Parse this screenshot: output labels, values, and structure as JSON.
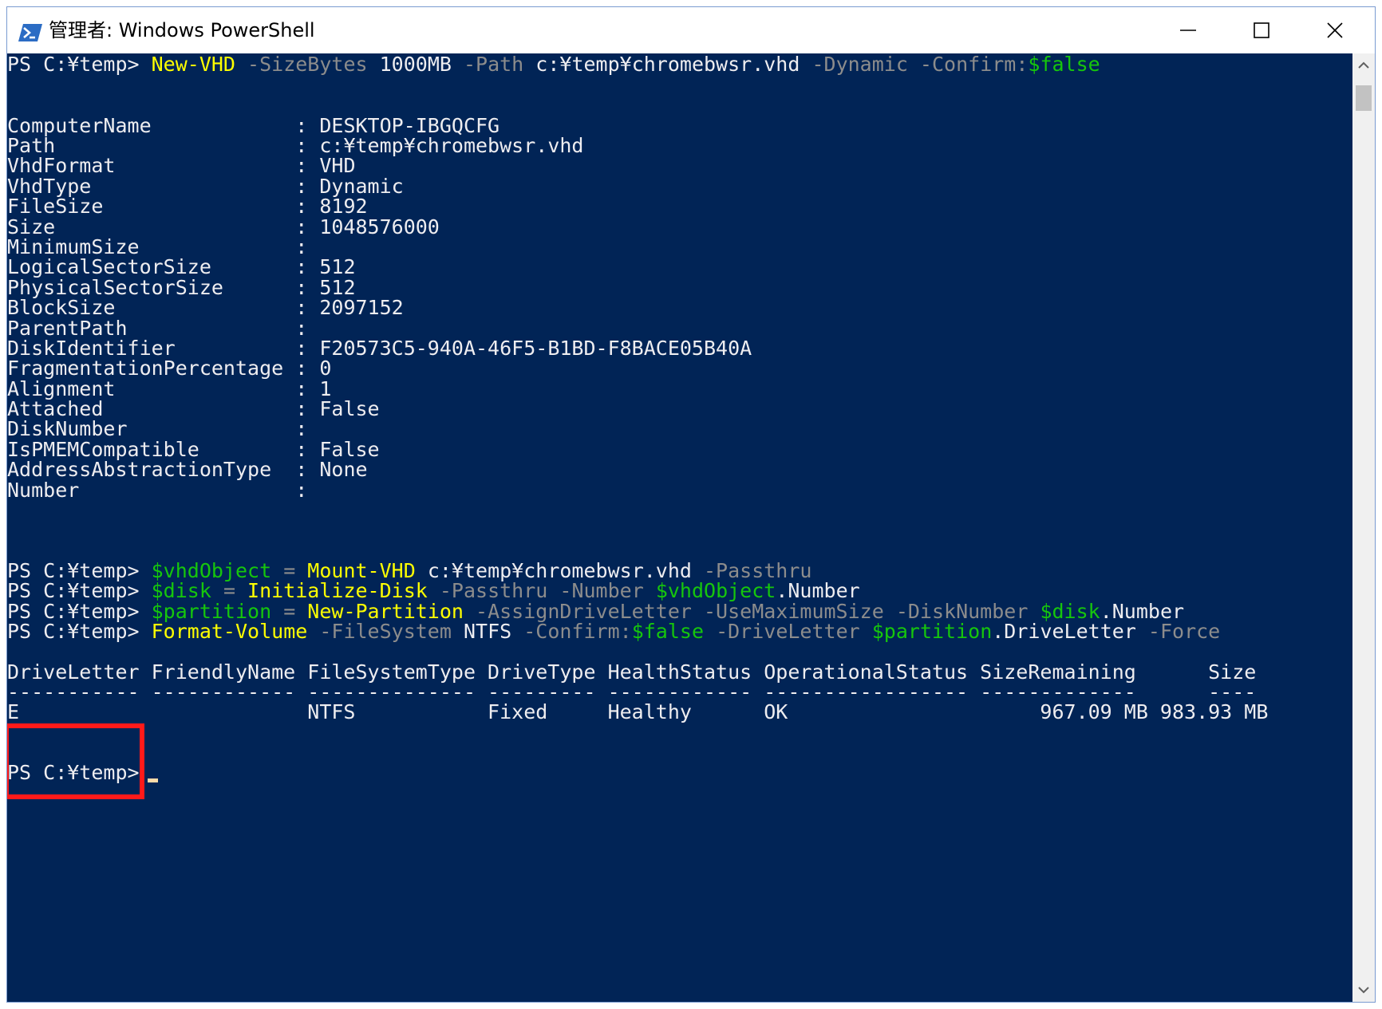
{
  "window": {
    "title": "管理者: Windows PowerShell"
  },
  "console": {
    "cmd1": {
      "prompt": "PS C:¥temp> ",
      "cmdlet": "New-VHD",
      "p1": " -SizeBytes",
      "v1": " 1000MB",
      "p2": " -Path",
      "v2": " c:¥temp¥chromebwsr.vhd",
      "p3": " -Dynamic -Confirm:",
      "v3": "$false"
    },
    "props": [
      {
        "name": "ComputerName           ",
        "value": "DESKTOP-IBGQCFG"
      },
      {
        "name": "Path                   ",
        "value": "c:¥temp¥chromebwsr.vhd"
      },
      {
        "name": "VhdFormat              ",
        "value": "VHD"
      },
      {
        "name": "VhdType                ",
        "value": "Dynamic"
      },
      {
        "name": "FileSize               ",
        "value": "8192"
      },
      {
        "name": "Size                   ",
        "value": "1048576000"
      },
      {
        "name": "MinimumSize            ",
        "value": ""
      },
      {
        "name": "LogicalSectorSize      ",
        "value": "512"
      },
      {
        "name": "PhysicalSectorSize     ",
        "value": "512"
      },
      {
        "name": "BlockSize              ",
        "value": "2097152"
      },
      {
        "name": "ParentPath             ",
        "value": ""
      },
      {
        "name": "DiskIdentifier         ",
        "value": "F20573C5-940A-46F5-B1BD-F8BACE05B40A"
      },
      {
        "name": "FragmentationPercentage",
        "value": "0"
      },
      {
        "name": "Alignment              ",
        "value": "1"
      },
      {
        "name": "Attached               ",
        "value": "False"
      },
      {
        "name": "DiskNumber             ",
        "value": ""
      },
      {
        "name": "IsPMEMCompatible       ",
        "value": "False"
      },
      {
        "name": "AddressAbstractionType ",
        "value": "None"
      },
      {
        "name": "Number                 ",
        "value": ""
      }
    ],
    "separator": " : ",
    "cmd2": {
      "prompt": "PS C:¥temp> ",
      "var": "$vhdObject",
      "eq": " = ",
      "cmdlet": "Mount-VHD",
      "arg": " c:¥temp¥chromebwsr.vhd",
      "p1": " -Passthru"
    },
    "cmd3": {
      "prompt": "PS C:¥temp> ",
      "var": "$disk",
      "eq": " = ",
      "cmdlet": "Initialize-Disk",
      "p1": " -Passthru -Number ",
      "v1": "$vhdObject",
      "v1b": ".Number"
    },
    "cmd4": {
      "prompt": "PS C:¥temp> ",
      "var": "$partition",
      "eq": " = ",
      "cmdlet": "New-Partition",
      "p1": " -AssignDriveLetter -UseMaximumSize -DiskNumber ",
      "v1": "$disk",
      "v1b": ".Number"
    },
    "cmd5": {
      "prompt": "PS C:¥temp> ",
      "cmdlet": "Format-Volume",
      "p1": " -FileSystem",
      "v1": " NTFS",
      "p2": " -Confirm:",
      "v2": "$false",
      "p3": " -DriveLetter ",
      "v3": "$partition",
      "v3b": ".DriveLetter",
      "p4": " -Force"
    },
    "table": {
      "header": "DriveLetter FriendlyName FileSystemType DriveType HealthStatus OperationalStatus SizeRemaining      Size",
      "dashes": "----------- ------------ -------------- --------- ------------ ----------------- -------------      ----",
      "row": "E                        NTFS           Fixed     Healthy      OK                     967.09 MB 983.93 MB"
    },
    "final_prompt": "PS C:¥temp>"
  }
}
